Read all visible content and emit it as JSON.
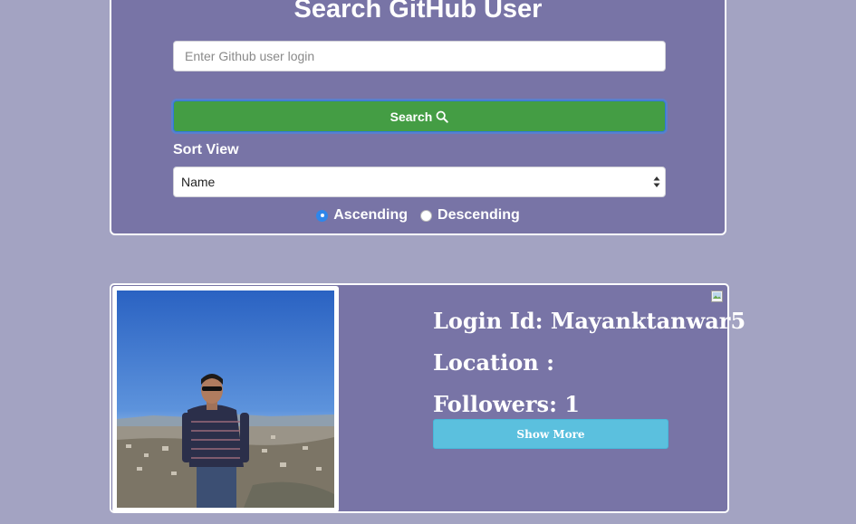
{
  "search": {
    "title": "Search GitHub User",
    "input_placeholder": "Enter Github user login",
    "input_value": "",
    "button_label": "Search",
    "button_icon": "search-icon"
  },
  "sort": {
    "label": "Sort View",
    "selected": "Name",
    "order_options": [
      {
        "label": "Ascending",
        "checked": true
      },
      {
        "label": "Descending",
        "checked": false
      }
    ]
  },
  "user": {
    "login_label": "Login Id: ",
    "login": "Mayanktanwar5",
    "location_label": "Location : ",
    "location": "",
    "followers_label": "Followers: ",
    "followers": "1",
    "show_more_label": "Show More"
  },
  "colors": {
    "page_bg": "#a3a3c2",
    "panel_bg": "#7874a6",
    "search_button": "#449d44",
    "show_more_button": "#5bc0de",
    "radio_checked": "#2f86ea"
  }
}
